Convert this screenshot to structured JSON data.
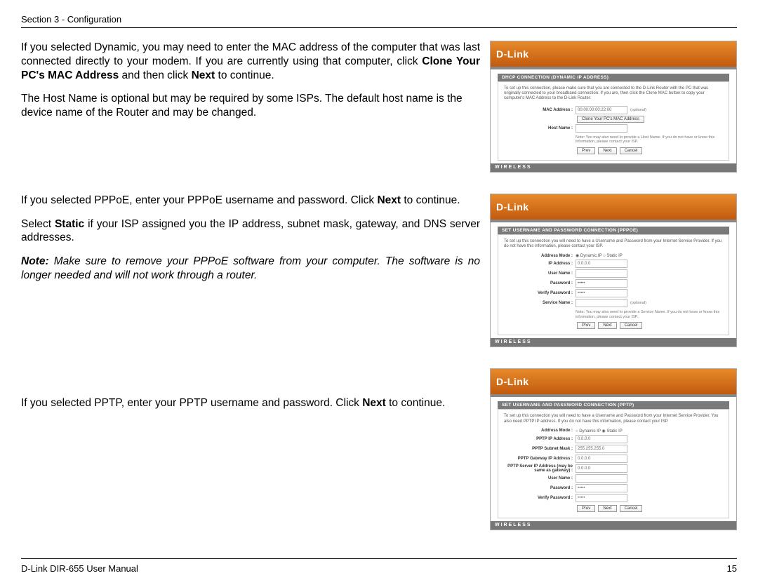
{
  "header": {
    "section": "Section 3 - Configuration"
  },
  "footer": {
    "left": "D-Link DIR-655 User Manual",
    "right": "15"
  },
  "brand": "D-Link",
  "wireless_label": "WIRELESS",
  "buttons": {
    "prev": "Prev",
    "next": "Next",
    "cancel": "Cancel"
  },
  "block1": {
    "p1_a": "If you selected Dynamic, you may need to enter the MAC address of the computer that was last connected directly to your modem. If you are currently using that computer, click ",
    "p1_bold": "Clone Your PC's MAC Address",
    "p1_b": " and then click ",
    "p1_bold2": "Next",
    "p1_c": " to continue.",
    "p2": "The Host Name is optional but may be required by some ISPs. The default host name is the device name of the Router and may be changed."
  },
  "block2": {
    "p1_a": "If you selected PPPoE, enter your PPPoE username and password. Click ",
    "p1_bold": "Next",
    "p1_b": " to continue.",
    "p2_a": "Select ",
    "p2_bold": "Static",
    "p2_b": " if your ISP assigned you the IP address, subnet mask, gateway, and DNS server addresses.",
    "note_bold": "Note:",
    "note": " Make sure to remove your PPPoE software from your computer. The software is no longer needed and will not work through a router."
  },
  "block3": {
    "p1_a": "If you selected PPTP, enter your PPTP username and password. Click ",
    "p1_bold": "Next",
    "p1_b": " to continue."
  },
  "shot1": {
    "title": "DHCP CONNECTION (DYNAMIC IP ADDRESS)",
    "desc": "To set up this connection, please make sure that you are connected to the D-Link Router with the PC that was originally connected to your broadband connection. If you are, then click the Clone MAC button to copy your computer's MAC Address to the D-Link Router.",
    "mac_lbl": "MAC Address :",
    "mac_val": "00:00:00:00:22:00",
    "mac_aux": "(optional)",
    "clone_btn": "Clone Your PC's MAC Address",
    "host_lbl": "Host Name :",
    "note": "Note: You may also need to provide a Host Name. If you do not have or know this information, please contact your ISP."
  },
  "shot2": {
    "title": "SET USERNAME AND PASSWORD CONNECTION (PPPOE)",
    "desc": "To set up this connection you will need to have a Username and Password from your Internet Service Provider. If you do not have this information, please contact your ISP.",
    "addr_lbl": "Address Mode :",
    "addr_radios": "◉ Dynamic IP   ○ Static IP",
    "ip_lbl": "IP Address :",
    "ip_val": "0.0.0.0",
    "user_lbl": "User Name :",
    "pass_lbl": "Password :",
    "pass_val": "•••••",
    "vpass_lbl": "Verify Password :",
    "svc_lbl": "Service Name :",
    "svc_aux": "(optional)",
    "note": "Note: You may also need to provide a Service Name. If you do not have or know this information, please contact your ISP."
  },
  "shot3": {
    "title": "SET USERNAME AND PASSWORD CONNECTION (PPTP)",
    "desc": "To set up this connection you will need to have a Username and Password from your Internet Service Provider. You also need PPTP IP address. If you do not have this information, please contact your ISP.",
    "addr_lbl": "Address Mode :",
    "addr_radios": "○ Dynamic IP   ◉ Static IP",
    "pptp_ip_lbl": "PPTP IP Address :",
    "pptp_ip_val": "0.0.0.0",
    "mask_lbl": "PPTP Subnet Mask :",
    "mask_val": "255.255.255.0",
    "gw_lbl": "PPTP Gateway IP Address :",
    "gw_val": "0.0.0.0",
    "srv_lbl": "PPTP Server IP Address (may be same as gateway) :",
    "srv_val": "0.0.0.0",
    "user_lbl": "User Name :",
    "pass_lbl": "Password :",
    "pass_val": "•••••",
    "vpass_lbl": "Verify Password :"
  }
}
